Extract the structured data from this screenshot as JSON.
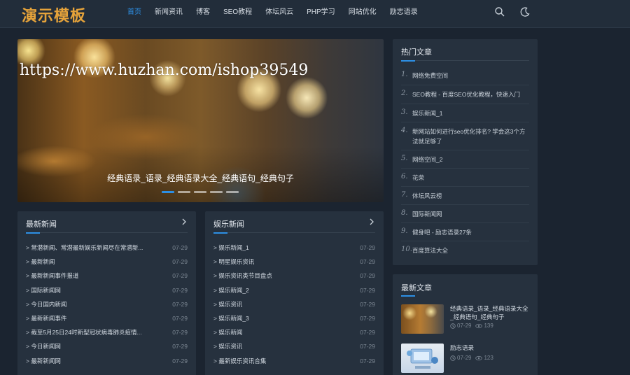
{
  "header": {
    "logo": "演示模板",
    "nav": [
      "首页",
      "新闻资讯",
      "博客",
      "SEO教程",
      "体坛风云",
      "PHP学习",
      "网站优化",
      "励志语录"
    ],
    "active_index": 0,
    "icons": [
      "search-icon",
      "moon-icon"
    ]
  },
  "slider": {
    "watermark": "https://www.huzhan.com/ishop39549",
    "caption": "经典语录_语录_经典语录大全_经典语句_经典句子",
    "dot_count": 5,
    "active_dot": 0
  },
  "latest_news": {
    "title": "最新新闻",
    "items": [
      {
        "title": "常潜新闻、常潜最新娱乐新闻尽在常潜新...",
        "date": "07-29"
      },
      {
        "title": "最新新闻",
        "date": "07-29"
      },
      {
        "title": "最新新闻事件报道",
        "date": "07-29"
      },
      {
        "title": "国际新闻网",
        "date": "07-29"
      },
      {
        "title": "今日国内新闻",
        "date": "07-29"
      },
      {
        "title": "最新新闻事件",
        "date": "07-29"
      },
      {
        "title": "截至5月25日24时新型冠状病毒肺炎疫情...",
        "date": "07-29"
      },
      {
        "title": "今日新闻网",
        "date": "07-29"
      },
      {
        "title": "最新新闻网",
        "date": "07-29"
      }
    ]
  },
  "ent_news": {
    "title": "娱乐新闻",
    "items": [
      {
        "title": "娱乐新闻_1",
        "date": "07-29"
      },
      {
        "title": "明星娱乐资讯",
        "date": "07-29"
      },
      {
        "title": "娱乐资讯类节目盘点",
        "date": "07-29"
      },
      {
        "title": "娱乐新闻_2",
        "date": "07-29"
      },
      {
        "title": "娱乐资讯",
        "date": "07-29"
      },
      {
        "title": "娱乐新闻_3",
        "date": "07-29"
      },
      {
        "title": "娱乐新闻",
        "date": "07-29"
      },
      {
        "title": "娱乐资讯",
        "date": "07-29"
      },
      {
        "title": "最新娱乐资讯合集",
        "date": "07-29"
      }
    ]
  },
  "hot_articles": {
    "title": "热门文章",
    "items": [
      {
        "num": "1.",
        "title": "网络免费空间"
      },
      {
        "num": "2.",
        "title": "SEO教程 - 百度SEO优化教程，快速入门"
      },
      {
        "num": "3.",
        "title": "娱乐新闻_1"
      },
      {
        "num": "4.",
        "title": "新网站如何进行seo优化排名? 学会这3个方法就足够了"
      },
      {
        "num": "5.",
        "title": "网络空间_2"
      },
      {
        "num": "6.",
        "title": "花荣"
      },
      {
        "num": "7.",
        "title": "体坛风云榜"
      },
      {
        "num": "8.",
        "title": "国际新闻网"
      },
      {
        "num": "9.",
        "title": "健身吧 - 励志语录27条"
      },
      {
        "num": "10.",
        "title": "百度算法大全"
      }
    ]
  },
  "latest_articles": {
    "title": "最新文章",
    "items": [
      {
        "title": "经典语录_语录_经典语录大全_经典语句_经典句子",
        "date": "07-29",
        "views": "139"
      },
      {
        "title": "励志语录",
        "date": "07-29",
        "views": "123"
      }
    ]
  },
  "colors": {
    "background": "#1b2430",
    "panel": "#26313e",
    "accent": "#2d8fe4",
    "logo": "#e6a33a"
  }
}
